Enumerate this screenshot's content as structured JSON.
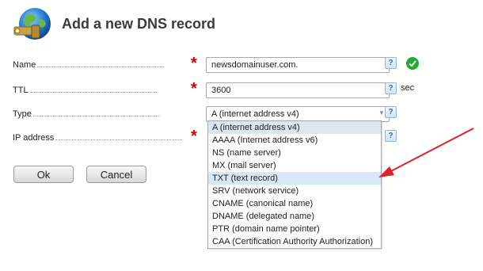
{
  "header": {
    "title": "Add a new DNS record",
    "icon": "globe-key-icon"
  },
  "form": {
    "name": {
      "label": "Name",
      "value": "newsdomainuser.com.",
      "required_mark": "*",
      "help": "?",
      "status_icon": "valid-check-icon"
    },
    "ttl": {
      "label": "TTL",
      "value": "3600",
      "required_mark": "*",
      "help": "?",
      "unit": "sec"
    },
    "type": {
      "label": "Type",
      "help": "?",
      "selected": "A (internet address v4)",
      "options": [
        "A (internet address v4)",
        "AAAA (Internet address v6)",
        "NS (name server)",
        "MX (mail server)",
        "TXT (text record)",
        "SRV (network service)",
        "CNAME (canonical name)",
        "DNAME (delegated name)",
        "PTR (domain name pointer)",
        "CAA (Certification Authority Authorization)"
      ],
      "highlighted_option": "TXT (text record)"
    },
    "ip_address": {
      "label": "IP address",
      "required_mark": "*",
      "help": "?"
    }
  },
  "buttons": {
    "ok": "Ok",
    "cancel": "Cancel"
  },
  "colors": {
    "required": "#d00000",
    "valid": "#22aa33",
    "arrow": "#e0202a",
    "hover": "#d6e8f7"
  }
}
